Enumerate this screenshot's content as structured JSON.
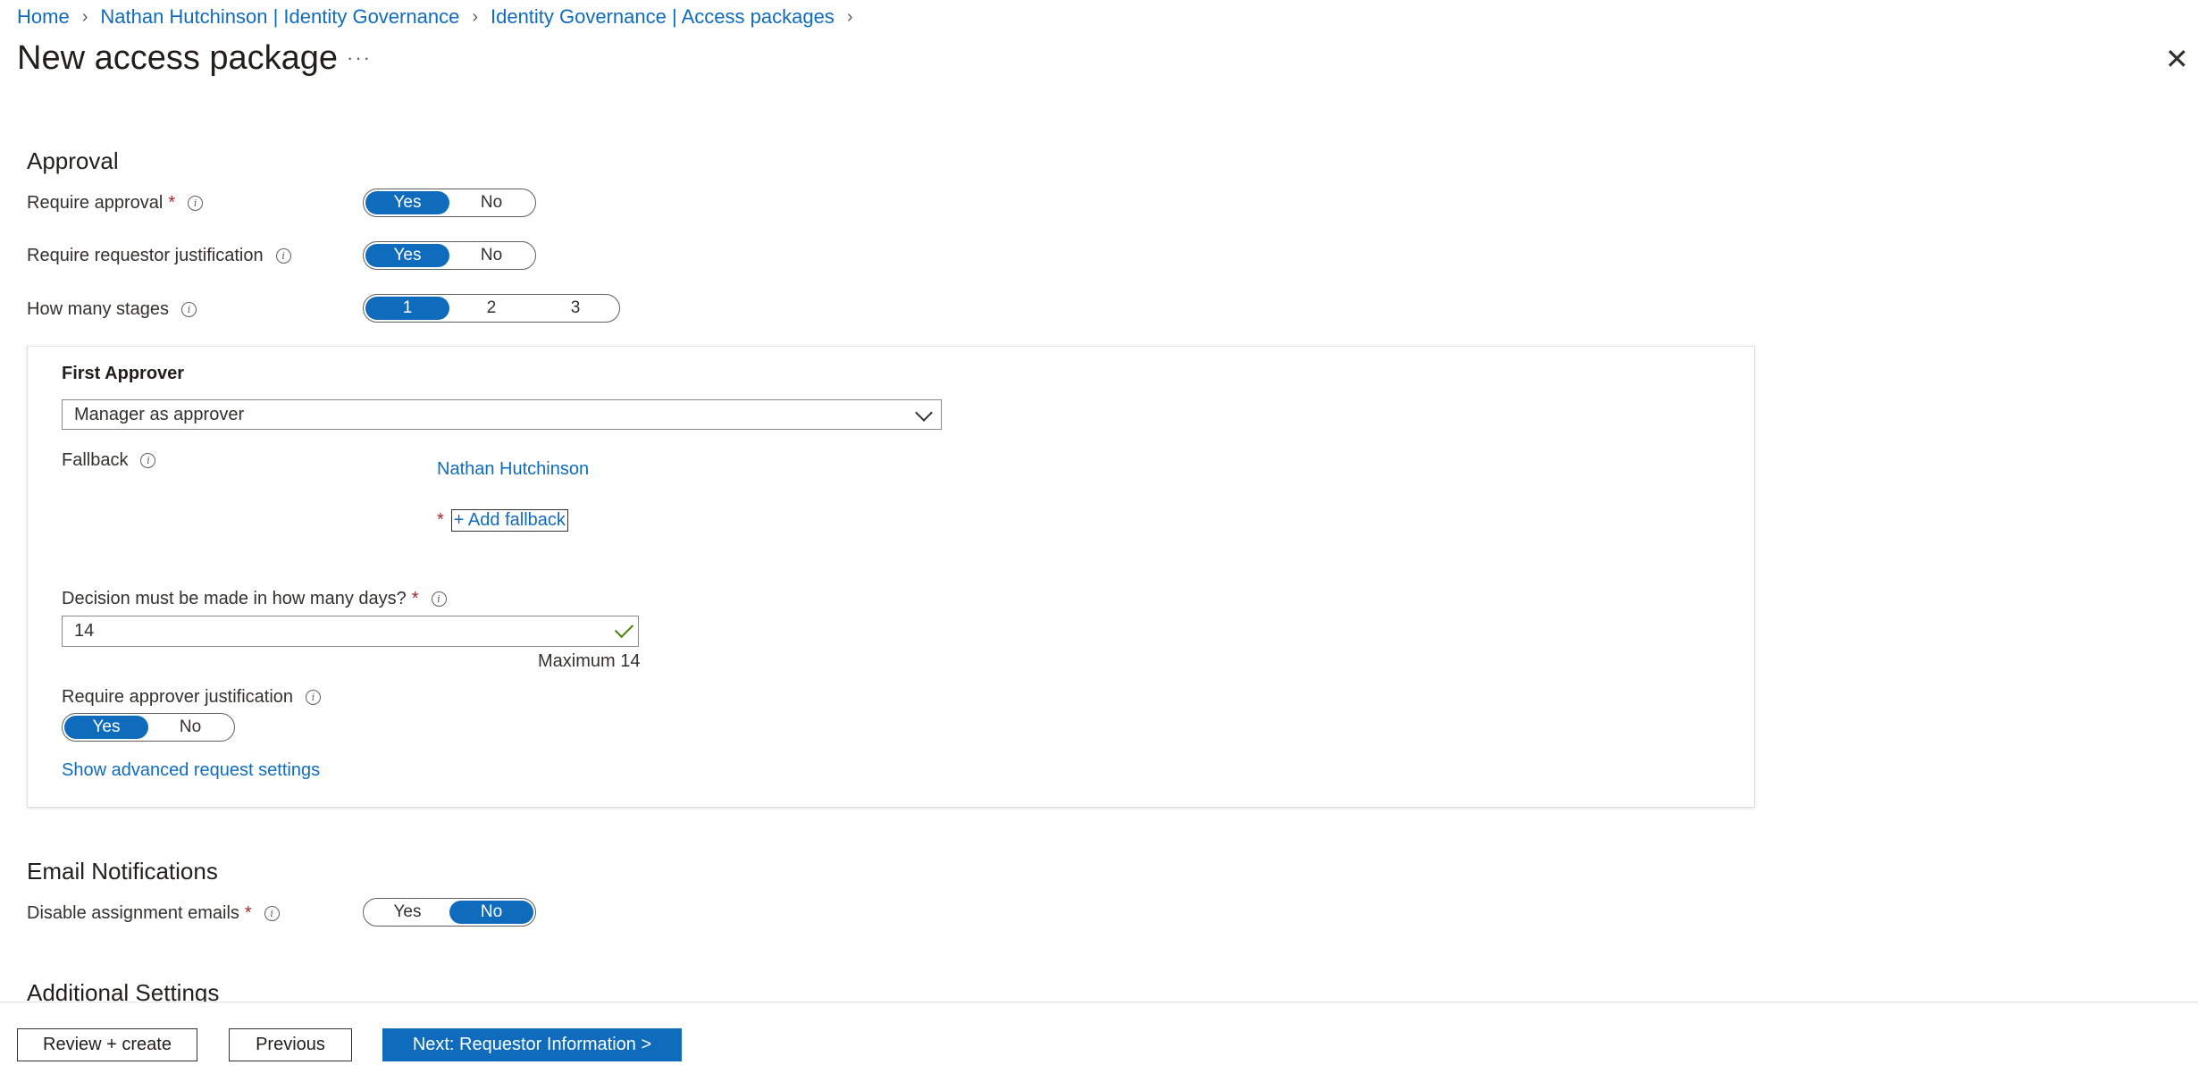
{
  "breadcrumb": {
    "items": [
      "Home",
      "Nathan Hutchinson | Identity Governance",
      "Identity Governance | Access packages"
    ]
  },
  "header": {
    "title": "New access package",
    "more_label": "···",
    "close_label": "✕"
  },
  "approval": {
    "heading": "Approval",
    "require_approval": {
      "label": "Require approval",
      "required": "*",
      "options": [
        "Yes",
        "No"
      ],
      "selected": "Yes"
    },
    "requestor_justification": {
      "label": "Require requestor justification",
      "options": [
        "Yes",
        "No"
      ],
      "selected": "Yes"
    },
    "stages": {
      "label": "How many stages",
      "options": [
        "1",
        "2",
        "3"
      ],
      "selected": "1"
    }
  },
  "first_approver": {
    "heading": "First Approver",
    "select_value": "Manager as approver",
    "fallback_label": "Fallback",
    "fallback_user": "Nathan Hutchinson",
    "add_fallback_required": "*",
    "add_fallback": "+ Add fallback",
    "decision_days_label": "Decision must be made in how many days?",
    "decision_days_required": "*",
    "decision_days_value": "14",
    "decision_days_hint": "Maximum 14",
    "approver_justification": {
      "label": "Require approver justification",
      "options": [
        "Yes",
        "No"
      ],
      "selected": "Yes"
    },
    "advanced_link": "Show advanced request settings"
  },
  "email": {
    "heading": "Email Notifications",
    "disable_emails": {
      "label": "Disable assignment emails",
      "required": "*",
      "options": [
        "Yes",
        "No"
      ],
      "selected": "No"
    }
  },
  "additional": {
    "heading": "Additional Settings"
  },
  "footer": {
    "review_create": "Review + create",
    "previous": "Previous",
    "next": "Next: Requestor Information >"
  },
  "colors": {
    "accent": "#0f6cbd",
    "required": "#a4262c",
    "success": "#498205"
  }
}
